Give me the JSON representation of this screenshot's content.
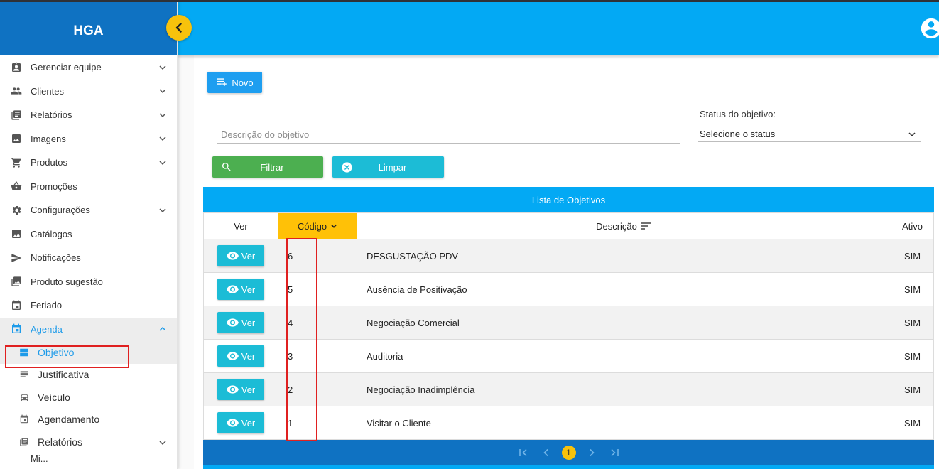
{
  "app": {
    "brand": "HGA"
  },
  "sidebar": {
    "items": [
      {
        "label": "Gerenciar equipe",
        "icon": "badge-icon",
        "expandable": true
      },
      {
        "label": "Clientes",
        "icon": "people-icon",
        "expandable": true
      },
      {
        "label": "Relatórios",
        "icon": "report-icon",
        "expandable": true
      },
      {
        "label": "Imagens",
        "icon": "image-icon",
        "expandable": true
      },
      {
        "label": "Produtos",
        "icon": "cart-icon",
        "expandable": true
      },
      {
        "label": "Promoções",
        "icon": "basket-icon",
        "expandable": false
      },
      {
        "label": "Configurações",
        "icon": "gear-icon",
        "expandable": true
      },
      {
        "label": "Catálogos",
        "icon": "catalog-icon",
        "expandable": false
      },
      {
        "label": "Notificações",
        "icon": "send-icon",
        "expandable": false
      },
      {
        "label": "Produto sugestão",
        "icon": "gallery-icon",
        "expandable": false
      },
      {
        "label": "Feriado",
        "icon": "calendar-icon",
        "expandable": false
      },
      {
        "label": "Agenda",
        "icon": "calendar-icon",
        "expandable": true,
        "expanded": true
      }
    ],
    "agenda_sub": [
      {
        "label": "Objetivo",
        "icon": "objective-icon",
        "selected": true
      },
      {
        "label": "Justificativa",
        "icon": "notes-icon"
      },
      {
        "label": "Veículo",
        "icon": "car-icon"
      },
      {
        "label": "Agendamento",
        "icon": "calendar-icon"
      },
      {
        "label": "Relatórios",
        "icon": "report-icon",
        "expandable": true
      }
    ],
    "partial_item": "Mi..."
  },
  "toolbar": {
    "novo_label": "Novo"
  },
  "filters": {
    "description_placeholder": "Descrição do objetivo",
    "status_label": "Status do objetivo:",
    "status_value": "Selecione o status",
    "filter_button": "Filtrar",
    "clear_button": "Limpar"
  },
  "table": {
    "title": "Lista de Objetivos",
    "headers": {
      "ver": "Ver",
      "codigo": "Código",
      "descricao": "Descrição",
      "ativo": "Ativo"
    },
    "ver_label": "Ver",
    "rows": [
      {
        "codigo": "6",
        "descricao": "DESGUSTAÇÃO PDV",
        "ativo": "SIM"
      },
      {
        "codigo": "5",
        "descricao": "Ausência de Positivação",
        "ativo": "SIM"
      },
      {
        "codigo": "4",
        "descricao": "Negociação Comercial",
        "ativo": "SIM"
      },
      {
        "codigo": "3",
        "descricao": "Auditoria",
        "ativo": "SIM"
      },
      {
        "codigo": "2",
        "descricao": "Negociação Inadimplência",
        "ativo": "SIM"
      },
      {
        "codigo": "1",
        "descricao": "Visitar o Cliente",
        "ativo": "SIM"
      }
    ]
  },
  "pagination": {
    "current": "1"
  },
  "colors": {
    "primary": "#03a9f4",
    "brand": "#0f72c2",
    "accent": "#f7c20c",
    "success": "#4caf50",
    "info": "#1cbcd6"
  }
}
